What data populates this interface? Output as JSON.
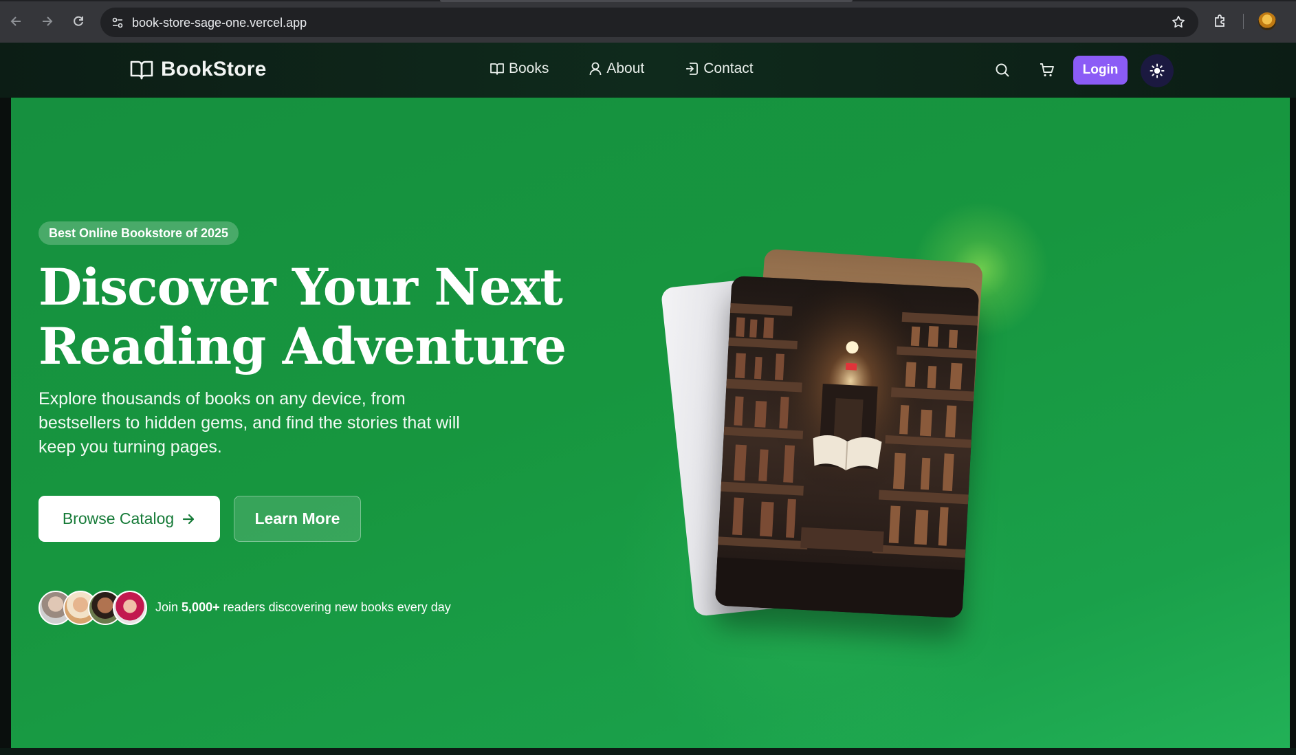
{
  "browser": {
    "url": "book-store-sage-one.vercel.app"
  },
  "site": {
    "brand": "BookStore",
    "nav": [
      {
        "label": "Books",
        "icon": "book-open-icon"
      },
      {
        "label": "About",
        "icon": "user-icon"
      },
      {
        "label": "Contact",
        "icon": "contact-icon"
      }
    ],
    "login_label": "Login",
    "colors": {
      "accent": "#8b5cf6",
      "hero_green": "#17963f",
      "header_bg": "#0f2a1c"
    }
  },
  "hero": {
    "badge": "Best Online Bookstore of 2025",
    "headline_line1": "Discover Your Next",
    "headline_line2": "Reading Adventure",
    "description": "Explore thousands of books on any device, from bestsellers to hidden gems, and find the stories that will keep you turning pages.",
    "primary_button": "Browse Catalog",
    "secondary_button": "Learn More",
    "social_proof": {
      "prefix": "Join",
      "count": "5,000+",
      "suffix": "readers discovering new books every day"
    }
  }
}
